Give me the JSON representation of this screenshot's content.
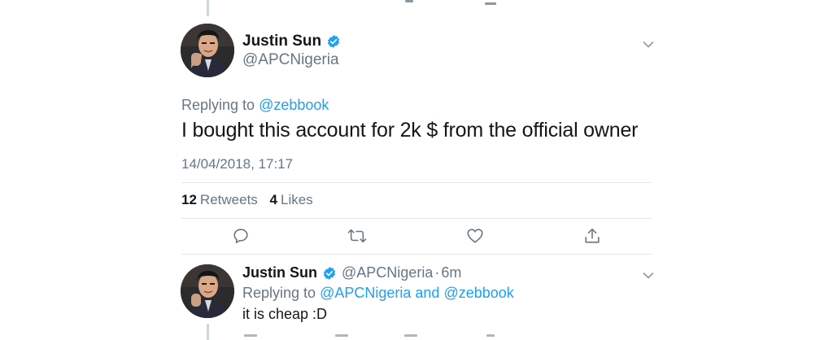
{
  "main_tweet": {
    "author_name": "Justin Sun",
    "author_handle": "@APCNigeria",
    "replying_label": "Replying to",
    "replying_to": "@zebbook",
    "text": "I bought this account for 2k $ from the official owner",
    "timestamp": "14/04/2018, 17:17",
    "retweets_count": "12",
    "retweets_label": "Retweets",
    "likes_count": "4",
    "likes_label": "Likes"
  },
  "reply_tweet": {
    "author_name": "Justin Sun",
    "author_handle": "@APCNigeria",
    "separator": "·",
    "time_ago": "6m",
    "replying_label": "Replying to",
    "replying_to_1": "@APCNigeria",
    "replying_and": "and",
    "replying_to_2": "@zebbook",
    "text": "it is cheap :D"
  },
  "icons": {
    "verified": "verified-badge-icon",
    "menu": "chevron-down-icon",
    "reply": "reply-icon",
    "retweet": "retweet-icon",
    "like": "heart-icon",
    "share": "share-icon"
  },
  "colors": {
    "link": "#1da1f2",
    "secondary_text": "#657786",
    "primary_text": "#14171a",
    "divider": "#e1e8ed",
    "thread_line": "#ccd6dd"
  }
}
